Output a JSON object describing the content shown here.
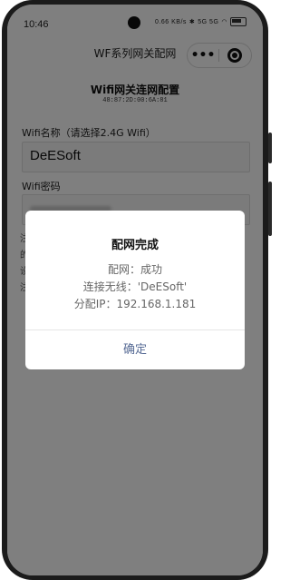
{
  "status_bar": {
    "time": "10:46",
    "speed": "0.66 KB/s",
    "icons_text": "5G 5G"
  },
  "nav": {
    "title": "WF系列网关配网",
    "more_icon": "more-dots-icon",
    "close_icon": "close-ring-icon"
  },
  "page": {
    "title": "Wifi网关连网配置",
    "mac": "48:87:2D:00:6A:81",
    "ssid_label": "Wifi名称（请选择2.4G Wifi）",
    "ssid_value": "DeESoft",
    "password_label": "Wifi密码",
    "side_glyphs": [
      "注",
      "的",
      "设",
      "注"
    ]
  },
  "dialog": {
    "title": "配网完成",
    "line1": "配网：成功",
    "line2": "连接无线：'DeESoft'",
    "line3": "分配IP：192.168.1.181",
    "confirm_label": "确定"
  },
  "colors": {
    "overlay": "#000000",
    "dialog_button": "#576b95"
  }
}
